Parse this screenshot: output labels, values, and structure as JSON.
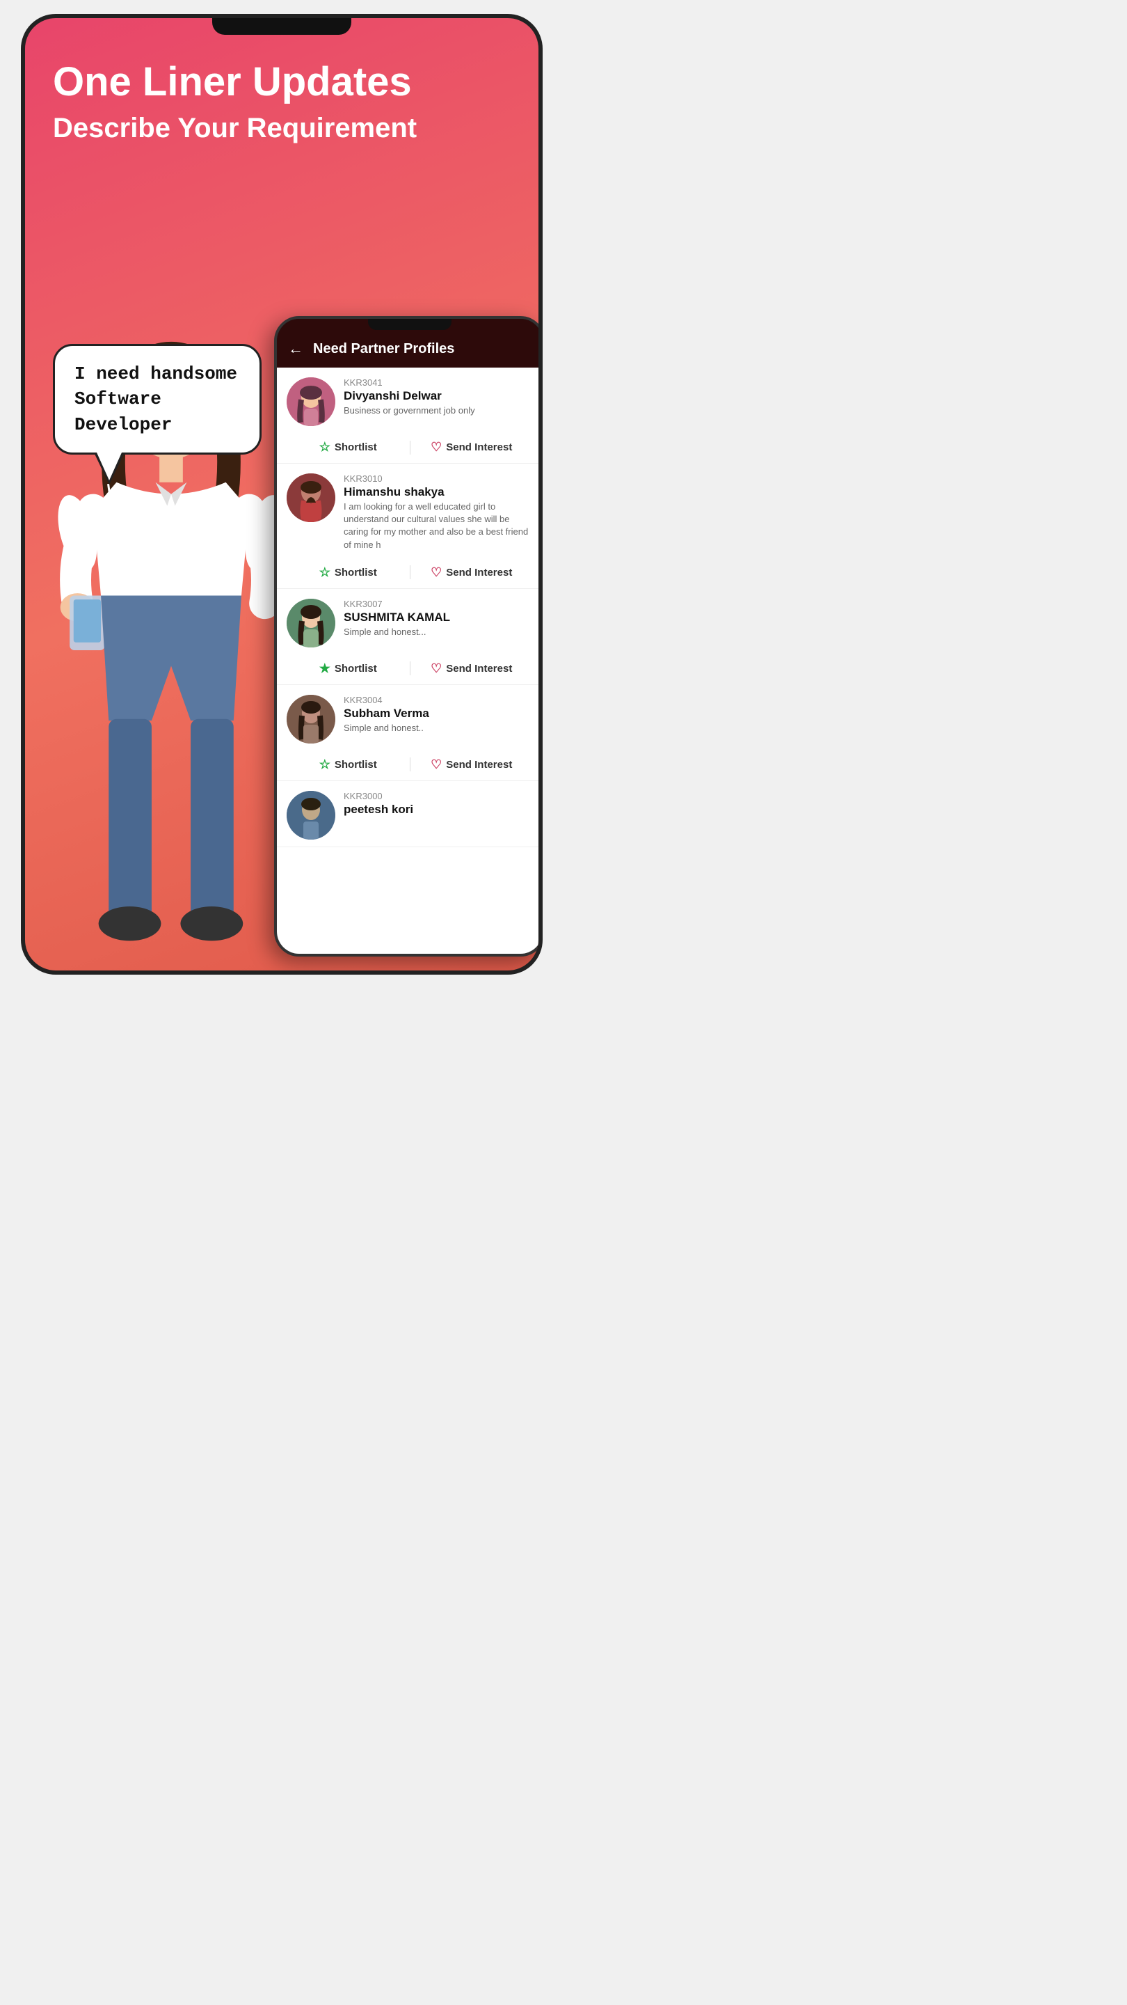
{
  "hero": {
    "title": "One Liner Updates",
    "subtitle": "Describe Your Requirement"
  },
  "speech": {
    "text": "I need handsome\nSoftware Developer"
  },
  "inner_app": {
    "header": {
      "back_label": "←",
      "title": "Need Partner Profiles"
    },
    "profiles": [
      {
        "id": "KKR3041",
        "name": "Divyanshi Delwar",
        "bio": "Business or government job only",
        "shortlisted": false,
        "avatar_color1": "#c06080",
        "avatar_color2": "#e08090",
        "avatar_class": "avatar-divyanshi"
      },
      {
        "id": "KKR3010",
        "name": "Himanshu shakya",
        "bio": "I am looking for a well educated girl to understand our cultural values she will be caring for my mother and also be a best friend of mine h",
        "shortlisted": false,
        "avatar_color1": "#8b3a3a",
        "avatar_color2": "#c05050",
        "avatar_class": "avatar-himanshu"
      },
      {
        "id": "KKR3007",
        "name": "SUSHMITA KAMAL",
        "bio": "Simple and honest...",
        "shortlisted": true,
        "avatar_color1": "#5a8a6a",
        "avatar_color2": "#7aaa8a",
        "avatar_class": "avatar-sushmita"
      },
      {
        "id": "KKR3004",
        "name": "Subham Verma",
        "bio": "Simple and honest..",
        "shortlisted": false,
        "avatar_color1": "#7a5a4a",
        "avatar_color2": "#aa7a6a",
        "avatar_class": "avatar-subham"
      },
      {
        "id": "KKR3000",
        "name": "peetesh kori",
        "bio": "",
        "shortlisted": false,
        "avatar_color1": "#4a6a8a",
        "avatar_color2": "#6a8aaa",
        "avatar_class": "avatar-peetesh"
      }
    ],
    "actions": {
      "shortlist_label": "Shortlist",
      "send_interest_label": "Send Interest"
    }
  }
}
